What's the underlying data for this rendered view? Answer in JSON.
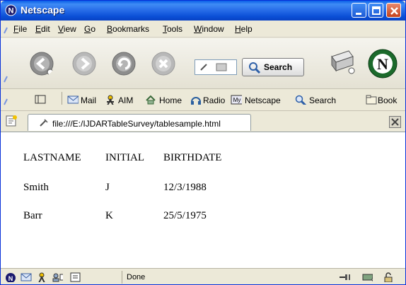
{
  "window": {
    "title": "Netscape"
  },
  "menu": [
    "File",
    "Edit",
    "View",
    "Go",
    "Bookmarks",
    "Tools",
    "Window",
    "Help"
  ],
  "menu_access": [
    "F",
    "E",
    "V",
    "G",
    "B",
    "T",
    "W",
    "H"
  ],
  "navbar": {
    "search_label": "Search"
  },
  "personal_toolbar": [
    "Mail",
    "AIM",
    "Home",
    "Radio",
    "Netscape",
    "Search",
    "Book"
  ],
  "tab": {
    "url": "file:///E:/IJDARTableSurvey/tablesample.html"
  },
  "table": {
    "headers": [
      "LASTNAME",
      "INITIAL",
      "BIRTHDATE"
    ],
    "rows": [
      [
        "Smith",
        "J",
        "12/3/1988"
      ],
      [
        "Barr",
        "K",
        "25/5/1975"
      ]
    ]
  },
  "status": {
    "text": "Done"
  },
  "colors": {
    "title_blue": "#0a4fd6",
    "close_red": "#c4421b"
  }
}
